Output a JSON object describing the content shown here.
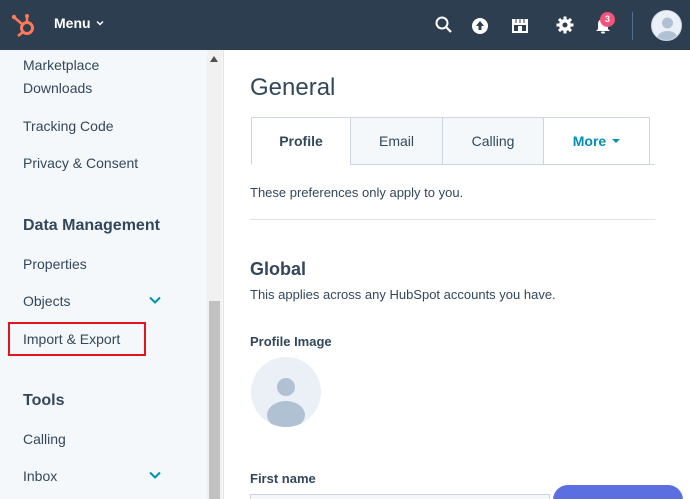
{
  "topnav": {
    "menu_label": "Menu",
    "notification_count": "3",
    "colors": {
      "background": "#2d3e50",
      "brand": "#ff7a59",
      "badge": "#f2547d"
    }
  },
  "sidebar": {
    "items": {
      "marketplace": "Marketplace",
      "downloads": "Downloads",
      "tracking_code": "Tracking Code",
      "privacy_consent": "Privacy & Consent",
      "properties": "Properties",
      "objects": "Objects",
      "import_export": "Import & Export",
      "calling": "Calling",
      "inbox": "Inbox"
    },
    "headers": {
      "data_management": "Data Management",
      "tools": "Tools"
    },
    "highlight_color": "#e3141c"
  },
  "main": {
    "title": "General",
    "tabs": [
      {
        "label": "Profile"
      },
      {
        "label": "Email"
      },
      {
        "label": "Calling"
      },
      {
        "label": "More"
      }
    ],
    "pref_note": "These preferences only apply to you.",
    "global_title": "Global",
    "global_sub": "This applies across any HubSpot accounts you have.",
    "profile_image_label": "Profile Image",
    "first_name_label": "First name",
    "accent_color": "#0091ae"
  }
}
